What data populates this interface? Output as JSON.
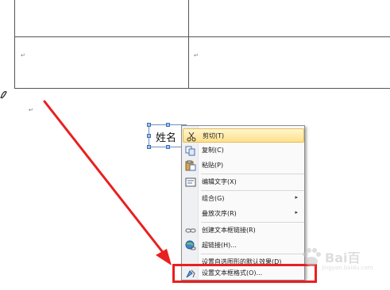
{
  "document": {
    "paragraph_mark": "↵"
  },
  "textbox": {
    "label": "姓名"
  },
  "context_menu": {
    "items": [
      {
        "label": "剪切(T)",
        "icon": "scissors-icon",
        "highlighted": true
      },
      {
        "label": "复制(C)",
        "icon": "copy-icon"
      },
      {
        "label": "粘贴(P)",
        "icon": "paste-icon"
      },
      {
        "label": "编辑文字(X)",
        "icon": "edit-text-icon"
      },
      {
        "label": "组合(G)",
        "submenu": true
      },
      {
        "label": "叠放次序(R)",
        "submenu": true
      },
      {
        "label": "创建文本框链接(R)",
        "icon": "link-chain-icon"
      },
      {
        "label": "超链接(H)...",
        "icon": "globe-link-icon"
      },
      {
        "label": "设置自选图形的默认效果(D)"
      },
      {
        "label": "设置文本框格式(O)...",
        "icon": "format-shape-icon"
      }
    ],
    "submenu_arrow": "▸"
  },
  "annotation": {
    "color": "#e8201f"
  },
  "watermark": {
    "text": "Bai百",
    "url": "jingyan.baidu.com"
  }
}
